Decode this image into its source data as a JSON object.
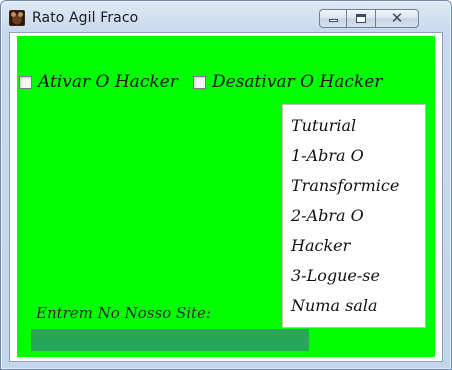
{
  "window": {
    "title": "Rato Agil Fraco",
    "icon": "rat-face-icon",
    "controls": [
      "minimize-icon",
      "maximize-icon",
      "close-icon"
    ]
  },
  "colors": {
    "background": "#00ff00",
    "site_field": "#28a856"
  },
  "options": {
    "activate_label": "Ativar O Hacker",
    "activate_checked": false,
    "deactivate_label": "Desativar O Hacker",
    "deactivate_checked": false
  },
  "tutorial": {
    "lines": [
      "Tuturial",
      "1-Abra O",
      "Transformice",
      "2-Abra O",
      "Hacker",
      "3-Logue-se",
      "Numa sala"
    ]
  },
  "site": {
    "label": "Entrem No Nosso Site:",
    "value": ""
  }
}
